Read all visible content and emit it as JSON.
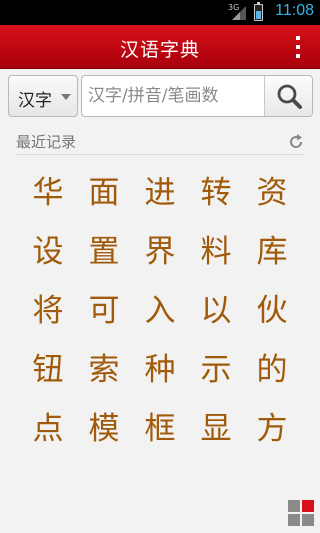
{
  "status_bar": {
    "network": "3G",
    "time": "11:08",
    "battery_level": 0.55
  },
  "app_bar": {
    "title": "汉语字典",
    "menu_icon": "overflow-menu-icon"
  },
  "search": {
    "mode_label": "汉字",
    "placeholder": "汉字/拼音/笔画数",
    "value": "",
    "button_icon": "search-icon"
  },
  "recent": {
    "label": "最近记录",
    "refresh_icon": "refresh-icon",
    "characters": [
      [
        "华",
        "面",
        "进",
        "转",
        "资"
      ],
      [
        "设",
        "置",
        "界",
        "料",
        "库"
      ],
      [
        "将",
        "可",
        "入",
        "以",
        "伙"
      ],
      [
        "钮",
        "索",
        "种",
        "示",
        "的"
      ],
      [
        "点",
        "模",
        "框",
        "显",
        "方"
      ]
    ]
  },
  "bottom": {
    "grid_icon": "grid-view-icon"
  },
  "colors": {
    "app_bar": "#c8000f",
    "character": "#a05a0a",
    "status_time": "#33b5e5"
  }
}
